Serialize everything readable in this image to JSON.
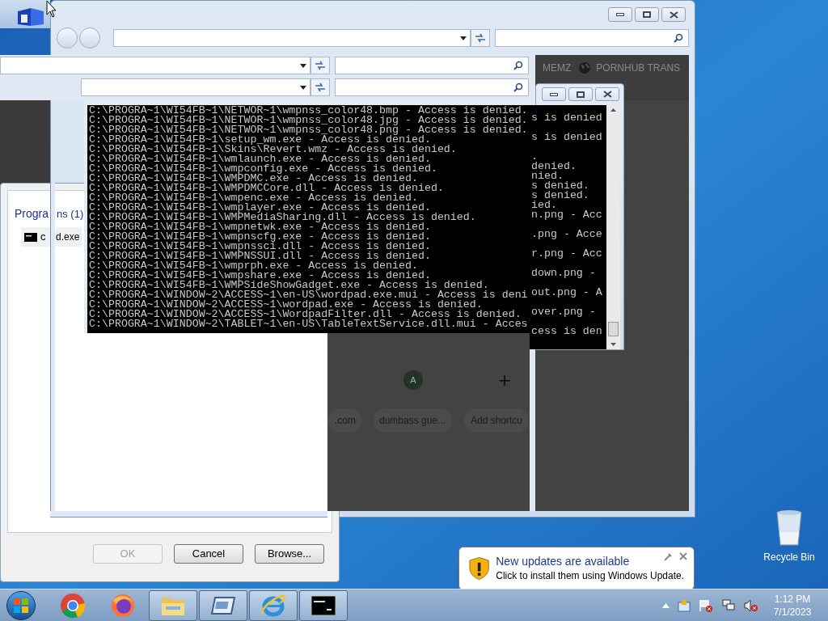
{
  "run_dialog": {
    "section_parts": [
      "Progra",
      "ns (1)"
    ],
    "results": [
      {
        "label_parts": [
          "c",
          "d.exe"
        ],
        "selected": false
      }
    ],
    "buttons": [
      {
        "label": "OK",
        "disabled": true
      },
      {
        "label": "Cancel",
        "disabled": false
      },
      {
        "label": "Browse...",
        "disabled": false
      }
    ]
  },
  "browser": {
    "bookmarks": [
      {
        "label": "MEMZ",
        "kind": "plain"
      },
      {
        "label": "PORNHUB TRANS",
        "kind": "globe"
      }
    ],
    "shortcuts": [
      {
        "label": ".com",
        "kind": "site"
      },
      {
        "label": "dumbass gue...",
        "kind": "avatar",
        "initial": "A"
      },
      {
        "label": "Add shortcu",
        "kind": "add",
        "icon": "+"
      }
    ]
  },
  "console": {
    "lines": [
      {
        "text": "C:\\PROGRA~1\\WI54FB~1\\NETWOR~1\\wmpnss_color48.bmp - Access is denied.",
        "behind": "s is denied"
      },
      {
        "text": "C:\\PROGRA~1\\WI54FB~1\\NETWOR~1\\wmpnss_color48.jpg - Access is denied."
      },
      {
        "text": "C:\\PROGRA~1\\WI54FB~1\\NETWOR~1\\wmpnss_color48.png - Access is denied.",
        "behind": "s is denied"
      },
      {
        "text": "C:\\PROGRA~1\\WI54FB~1\\setup_wm.exe - Access is denied."
      },
      {
        "text": "C:\\PROGRA~1\\WI54FB~1\\Skins\\Revert.wmz - Access is denied.",
        "behind": "."
      },
      {
        "text": "C:\\PROGRA~1\\WI54FB~1\\wmlaunch.exe - Access is denied.",
        "behind": "denied."
      },
      {
        "text": "C:\\PROGRA~1\\WI54FB~1\\wmpconfig.exe - Access is denied.",
        "behind": "nied."
      },
      {
        "text": "C:\\PROGRA~1\\WI54FB~1\\WMPDMC.exe - Access is denied.",
        "behind": "s denied."
      },
      {
        "text": "C:\\PROGRA~1\\WI54FB~1\\WMPDMCCore.dll - Access is denied.",
        "behind": "s denied."
      },
      {
        "text": "C:\\PROGRA~1\\WI54FB~1\\wmpenc.exe - Access is denied.",
        "behind": "ied."
      },
      {
        "text": "C:\\PROGRA~1\\WI54FB~1\\wmplayer.exe - Access is denied.",
        "behind": "n.png - Acc"
      },
      {
        "text": "C:\\PROGRA~1\\WI54FB~1\\WMPMediaSharing.dll - Access is denied."
      },
      {
        "text": "C:\\PROGRA~1\\WI54FB~1\\wmpnetwk.exe - Access is denied.",
        "behind": ".png - Acce"
      },
      {
        "text": "C:\\PROGRA~1\\WI54FB~1\\wmpnscfg.exe - Access is denied."
      },
      {
        "text": "C:\\PROGRA~1\\WI54FB~1\\wmpnssci.dll - Access is denied.",
        "behind": "r.png - Acc"
      },
      {
        "text": "C:\\PROGRA~1\\WI54FB~1\\WMPNSSUI.dll - Access is denied."
      },
      {
        "text": "C:\\PROGRA~1\\WI54FB~1\\wmprph.exe - Access is denied.",
        "behind": "down.png -"
      },
      {
        "text": "C:\\PROGRA~1\\WI54FB~1\\wmpshare.exe - Access is denied."
      },
      {
        "text": "C:\\PROGRA~1\\WI54FB~1\\WMPSideShowGadget.exe - Access is denied.",
        "behind": "out.png - A"
      },
      {
        "text": "C:\\PROGRA~1\\WINDOW~2\\ACCESS~1\\en-US\\wordpad.exe.mui - Access is deni"
      },
      {
        "text": "C:\\PROGRA~1\\WINDOW~2\\ACCESS~1\\wordpad.exe - Access is denied.",
        "behind": "over.png -"
      },
      {
        "text": "C:\\PROGRA~1\\WINDOW~2\\ACCESS~1\\WordpadFilter.dll - Access is denied."
      },
      {
        "text": "C:\\PROGRA~1\\WINDOW~2\\TABLET~1\\en-US\\TableTextService.dll.mui - Acces",
        "behind": "cess is den"
      }
    ]
  },
  "taskbar": {
    "apps": [
      {
        "kind": "chrome",
        "running": false
      },
      {
        "kind": "firefox",
        "running": false
      },
      {
        "kind": "folder",
        "running": true
      },
      {
        "kind": "window",
        "running": true
      },
      {
        "kind": "ie",
        "running": true
      },
      {
        "kind": "console",
        "running": true
      }
    ]
  },
  "notification": {
    "title": "New updates are available",
    "body": "Click to install them using Windows Update."
  },
  "tray": {
    "time": "1:12 PM",
    "date": "7/1/2023"
  },
  "desktop_icons": [
    {
      "label": "Recycle Bin"
    }
  ]
}
